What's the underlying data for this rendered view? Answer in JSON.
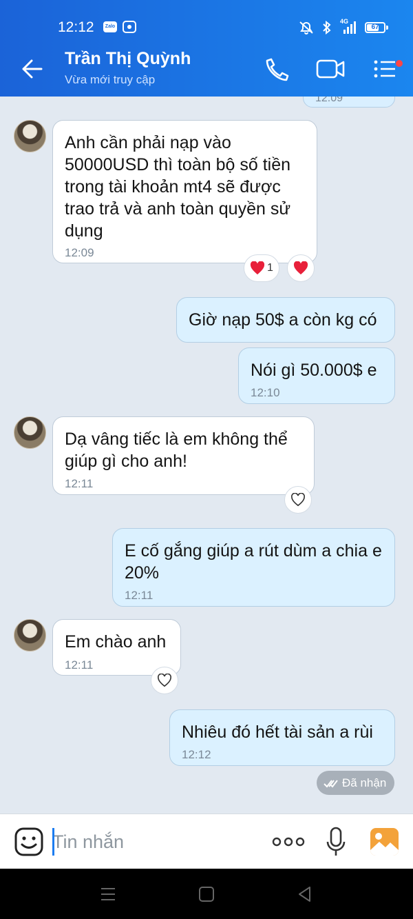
{
  "status_bar": {
    "time": "12:12",
    "zalo_label": "Zalo",
    "network": "4G",
    "battery": "67",
    "battery_level": 0.67
  },
  "header": {
    "contact_name": "Trần Thị Quỳnh",
    "contact_status": "Vừa mới truy cập",
    "icons": [
      "back-arrow-icon",
      "phone-icon",
      "video-camera-icon",
      "menu-icon"
    ]
  },
  "previous_message": {
    "time": "12:09"
  },
  "messages": [
    {
      "direction": "in",
      "text": "Anh cần phải nạp vào 50000USD thì toàn bộ số tiền trong tài khoản mt4 sẽ được trao trả và anh toàn quyền sử dụng",
      "time": "12:09",
      "reaction_count": "1"
    },
    {
      "direction": "out",
      "text": "Giờ nạp 50$ a còn kg có",
      "time": ""
    },
    {
      "direction": "out",
      "text": "Nói gì 50.000$ e",
      "time": "12:10"
    },
    {
      "direction": "in",
      "text": "Dạ vâng tiếc là em không thể giúp gì cho anh!",
      "time": "12:11"
    },
    {
      "direction": "out",
      "text": "E cố gắng giúp a rút dùm a chia e 20%",
      "time": "12:11"
    },
    {
      "direction": "in",
      "text": "Em chào anh",
      "time": "12:11"
    },
    {
      "direction": "out",
      "text": "Nhiêu đó hết tài sản a rùi",
      "time": "12:12"
    }
  ],
  "seen_status": "Đã nhận",
  "input": {
    "placeholder": "Tin nhắn",
    "value": ""
  },
  "colors": {
    "header": "#1b7cf0",
    "outgoing_bubble": "#dbf1ff",
    "incoming_bubble": "#ffffff",
    "chat_background": "#e2e9f1",
    "heart": "#e8203a"
  }
}
